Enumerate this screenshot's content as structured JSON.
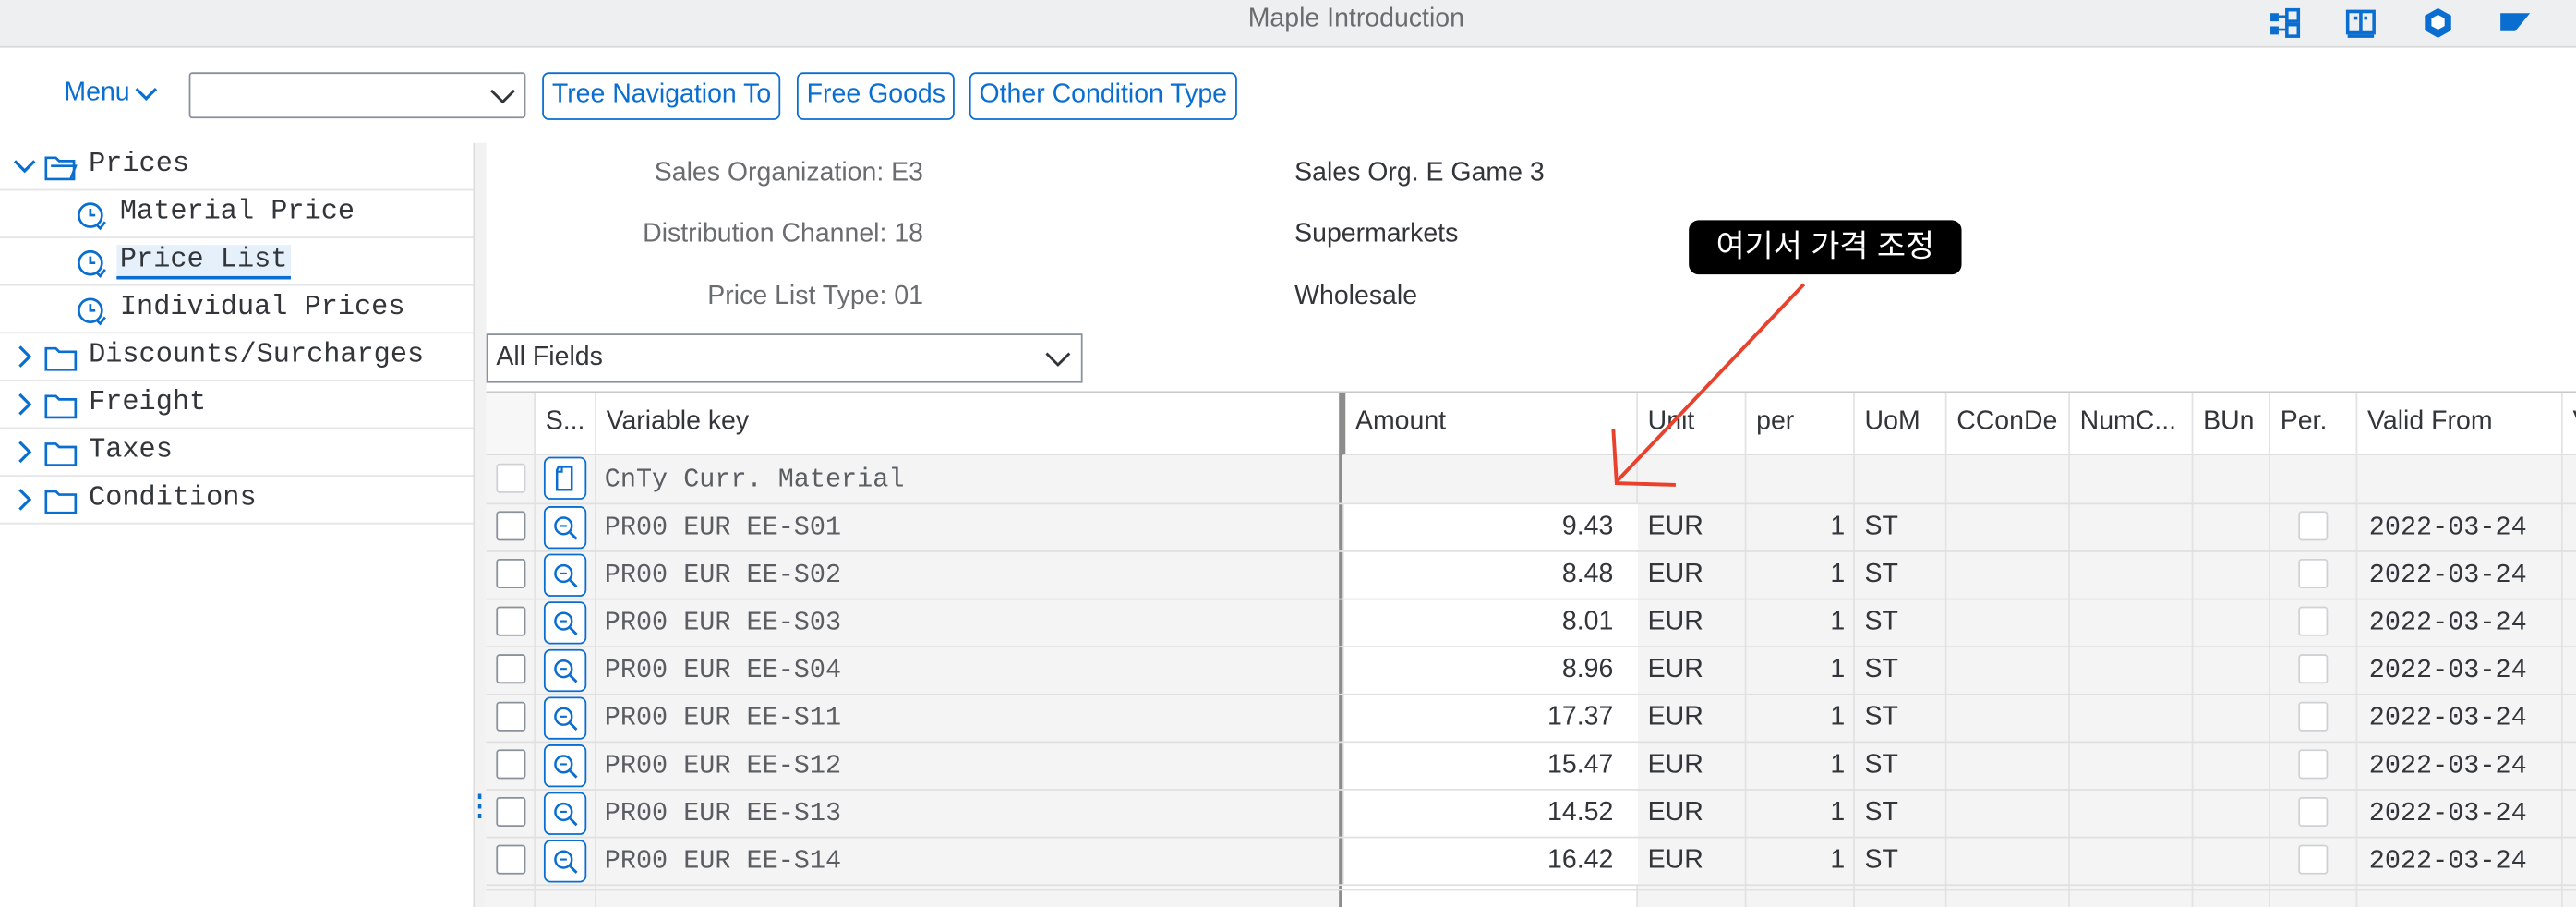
{
  "window": {
    "title": "Maple Introduction"
  },
  "toolbar": {
    "menu_label": "Menu",
    "combo_value": "",
    "buttons": [
      "Tree Navigation To",
      "Free Goods",
      "Other Condition Type"
    ]
  },
  "tree": {
    "items": [
      {
        "label": "Prices",
        "expanded": true,
        "level": 0
      },
      {
        "label": "Material Price",
        "level": 1
      },
      {
        "label": "Price List",
        "level": 1,
        "selected": true
      },
      {
        "label": "Individual Prices",
        "level": 1
      },
      {
        "label": "Discounts/Surcharges",
        "level": 0
      },
      {
        "label": "Freight",
        "level": 0
      },
      {
        "label": "Taxes",
        "level": 0
      },
      {
        "label": "Conditions",
        "level": 0
      }
    ]
  },
  "header": {
    "sales_org": {
      "label": "Sales Organization: E3",
      "desc": "Sales Org. E Game 3"
    },
    "dist_channel": {
      "label": "Distribution Channel: 18",
      "desc": "Supermarkets"
    },
    "price_list_type": {
      "label": "Price List Type: 01",
      "desc": "Wholesale"
    }
  },
  "field_selector": {
    "value": "All Fields"
  },
  "annotation": {
    "text": "여기서 가격 조정"
  },
  "table": {
    "columns": [
      "S...",
      "Variable key",
      "Amount",
      "Unit",
      "per",
      "UoM",
      "CConDe",
      "NumC...",
      "BUn",
      "Per.",
      "Valid From",
      "V"
    ],
    "subheader": "CnTy Curr. Material",
    "rows": [
      {
        "key": "PR00 EUR   EE-S01",
        "amount": "9.43",
        "unit": "EUR",
        "per": "1",
        "uom": "ST",
        "valid_from": "2022-03-24"
      },
      {
        "key": "PR00 EUR   EE-S02",
        "amount": "8.48",
        "unit": "EUR",
        "per": "1",
        "uom": "ST",
        "valid_from": "2022-03-24"
      },
      {
        "key": "PR00 EUR   EE-S03",
        "amount": "8.01",
        "unit": "EUR",
        "per": "1",
        "uom": "ST",
        "valid_from": "2022-03-24"
      },
      {
        "key": "PR00 EUR   EE-S04",
        "amount": "8.96",
        "unit": "EUR",
        "per": "1",
        "uom": "ST",
        "valid_from": "2022-03-24"
      },
      {
        "key": "PR00 EUR   EE-S11",
        "amount": "17.37",
        "unit": "EUR",
        "per": "1",
        "uom": "ST",
        "valid_from": "2022-03-24"
      },
      {
        "key": "PR00 EUR   EE-S12",
        "amount": "15.47",
        "unit": "EUR",
        "per": "1",
        "uom": "ST",
        "valid_from": "2022-03-24"
      },
      {
        "key": "PR00 EUR   EE-S13",
        "amount": "14.52",
        "unit": "EUR",
        "per": "1",
        "uom": "ST",
        "valid_from": "2022-03-24"
      },
      {
        "key": "PR00 EUR   EE-S14",
        "amount": "16.42",
        "unit": "EUR",
        "per": "1",
        "uom": "ST",
        "valid_from": "2022-03-24"
      }
    ]
  },
  "colors": {
    "accent": "#0a6ed1",
    "annotation_arrow": "#e8412c"
  }
}
